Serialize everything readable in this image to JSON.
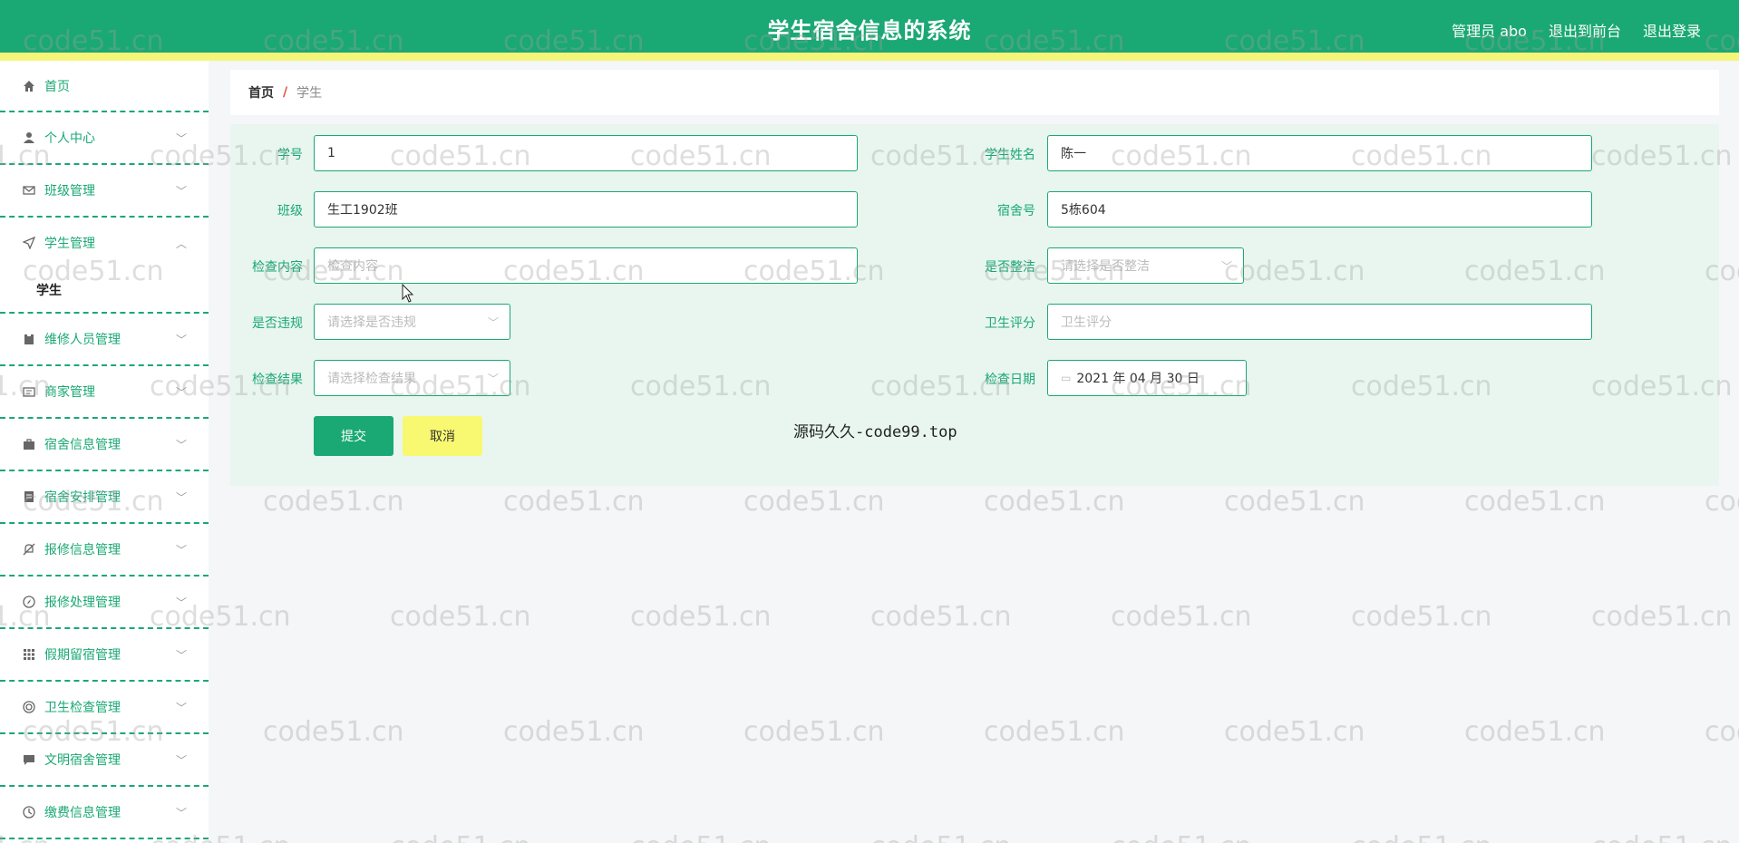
{
  "header": {
    "title": "学生宿舍信息的系统",
    "admin_label": "管理员 abo",
    "front_label": "退出到前台",
    "logout_label": "退出登录",
    "colors": {
      "primary": "#1aa874",
      "stripe": "#f5f57a"
    }
  },
  "sidebar": {
    "items": [
      {
        "label": "首页",
        "icon": "home-icon"
      },
      {
        "label": "个人中心",
        "icon": "user-icon"
      },
      {
        "label": "班级管理",
        "icon": "mail-icon"
      },
      {
        "label": "学生管理",
        "icon": "send-icon",
        "expanded": true,
        "sub": "学生"
      },
      {
        "label": "维修人员管理",
        "icon": "clipboard-icon"
      },
      {
        "label": "商家管理",
        "icon": "card-icon"
      },
      {
        "label": "宿舍信息管理",
        "icon": "briefcase-icon"
      },
      {
        "label": "宿舍安排管理",
        "icon": "document-icon"
      },
      {
        "label": "报修信息管理",
        "icon": "bell-off-icon"
      },
      {
        "label": "报修处理管理",
        "icon": "compass-icon"
      },
      {
        "label": "假期留宿管理",
        "icon": "grid-icon"
      },
      {
        "label": "卫生检查管理",
        "icon": "target-icon"
      },
      {
        "label": "文明宿舍管理",
        "icon": "chat-icon"
      },
      {
        "label": "缴费信息管理",
        "icon": "clock-icon"
      }
    ]
  },
  "breadcrumb": {
    "home": "首页",
    "separator": "/",
    "current": "学生"
  },
  "form": {
    "student_id_label": "学号",
    "student_id_value": "1",
    "student_name_label": "学生姓名",
    "student_name_value": "陈一",
    "class_label": "班级",
    "class_value": "生工1902班",
    "dorm_label": "宿舍号",
    "dorm_value": "5栋604",
    "inspect_content_label": "检查内容",
    "inspect_content_placeholder": "检查内容",
    "tidy_label": "是否整洁",
    "tidy_placeholder": "请选择是否整洁",
    "violation_label": "是否违规",
    "violation_placeholder": "请选择是否违规",
    "hygiene_label": "卫生评分",
    "hygiene_placeholder": "卫生评分",
    "result_label": "检查结果",
    "result_placeholder": "请选择检查结果",
    "date_label": "检查日期",
    "date_value": "2021 年 04 月 30 日",
    "submit_label": "提交",
    "cancel_label": "取消"
  },
  "overlay_text": "源码久久-code99.top",
  "watermark": "code51.cn"
}
